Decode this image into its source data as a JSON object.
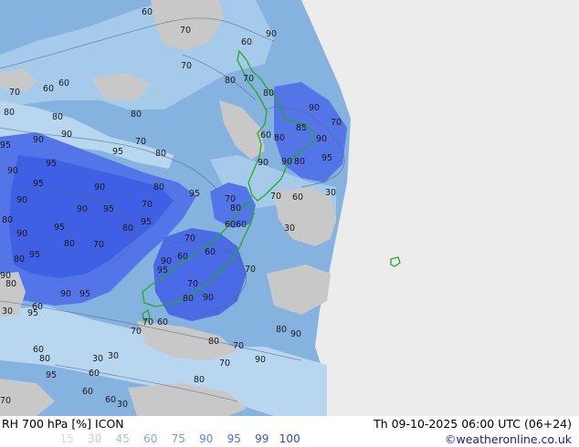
{
  "header": {
    "title": "RH 700 hPa [%] ICON",
    "valid_time": "Th 09-10-2025 06:00 UTC (06+24)",
    "credit": "©weatheronline.co.uk"
  },
  "legend": {
    "levels": [
      "15",
      "30",
      "45",
      "60",
      "75",
      "90",
      "95",
      "99",
      "100"
    ],
    "colors": [
      "#cfe3f3",
      "#b7d5ee",
      "#a0c6e8",
      "#86b2e0",
      "#6f9fe0",
      "#5b84e6",
      "#4a6de8",
      "#3a56e0",
      "#2e46d6"
    ],
    "no_data_color": "#ececec",
    "dry_color": "#c8c8c8"
  },
  "map": {
    "contour_labels": [
      "60",
      "70",
      "90",
      "60",
      "70",
      "80",
      "70",
      "60",
      "60",
      "70",
      "80",
      "80",
      "90",
      "70",
      "90",
      "85",
      "90",
      "80",
      "60",
      "80",
      "95",
      "95",
      "90",
      "95",
      "80",
      "80",
      "95",
      "90",
      "30",
      "70",
      "90",
      "90",
      "80",
      "60",
      "80",
      "70",
      "95",
      "95",
      "80",
      "70",
      "6060",
      "30",
      "90",
      "90",
      "95",
      "80",
      "90",
      "95",
      "70",
      "90",
      "95",
      "80",
      "80",
      "70",
      "70",
      "60",
      "95",
      "80",
      "90",
      "95",
      "90",
      "60",
      "70",
      "90",
      "95",
      "80",
      "30",
      "70",
      "80",
      "90",
      "95",
      "60",
      "70",
      "60",
      "70",
      "80",
      "90",
      "80",
      "70",
      "60",
      "80",
      "30",
      "70",
      "90",
      "30",
      "60",
      "80",
      "95",
      "60",
      "60",
      "70",
      "30"
    ]
  }
}
